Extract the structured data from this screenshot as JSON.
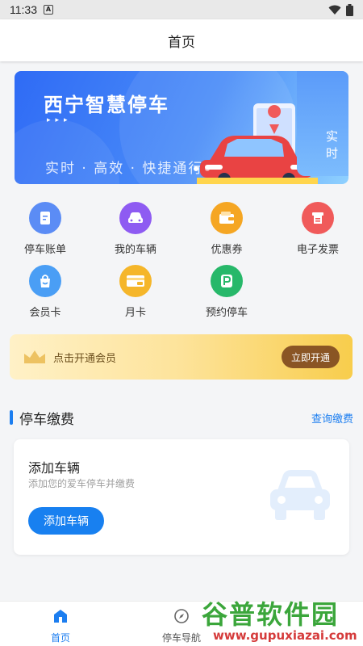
{
  "status_bar": {
    "time": "11:33",
    "notification_badge": "A"
  },
  "header": {
    "title": "首页"
  },
  "banner": {
    "title": "西宁智慧停车",
    "arrows": "▸▸▸",
    "slogan": "实时 · 高效 · 快捷通行",
    "next_slide_text": "实时"
  },
  "menu": {
    "items": [
      {
        "label": "停车账单",
        "icon": "bill-icon",
        "color": "#5b8cf5"
      },
      {
        "label": "我的车辆",
        "icon": "car-icon",
        "color": "#8e5bf2"
      },
      {
        "label": "优惠券",
        "icon": "wallet-icon",
        "color": "#f5a623"
      },
      {
        "label": "电子发票",
        "icon": "invoice-icon",
        "color": "#f05a5a"
      },
      {
        "label": "会员卡",
        "icon": "shopping-bag-icon",
        "color": "#4a9ef5"
      },
      {
        "label": "月卡",
        "icon": "vip-card-icon",
        "color": "#f5b62a"
      },
      {
        "label": "预约停车",
        "icon": "parking-icon",
        "color": "#27b86a"
      }
    ]
  },
  "member_banner": {
    "text": "点击开通会员",
    "button": "立即开通"
  },
  "parking_section": {
    "title": "停车缴费",
    "link": "查询缴费"
  },
  "vehicle_card": {
    "title": "添加车辆",
    "subtitle": "添加您的爱车停车并缴费",
    "button": "添加车辆"
  },
  "tabbar": {
    "tabs": [
      {
        "label": "首页",
        "icon": "home-icon",
        "active": true
      },
      {
        "label": "停车导航",
        "icon": "compass-icon",
        "active": false
      }
    ]
  },
  "watermark": {
    "title": "谷普软件园",
    "url": "www.gupuxiazai.com"
  },
  "colors": {
    "accent": "#1c7ef0",
    "member_button": "#8a5524"
  }
}
